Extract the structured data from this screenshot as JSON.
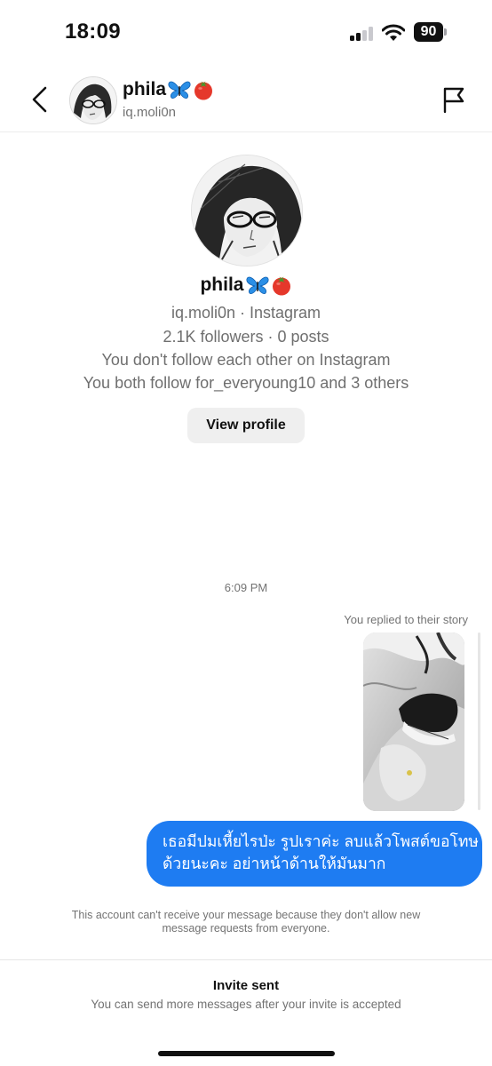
{
  "status_bar": {
    "time": "18:09",
    "battery": "90",
    "icons": [
      "cellular-signal-icon",
      "wifi-icon",
      "battery-icon"
    ]
  },
  "header": {
    "name": "phila",
    "name_emojis": [
      "butterfly-emoji",
      "tomato-emoji"
    ],
    "username": "iq.moli0n",
    "icons": [
      "chevron-left-icon",
      "flag-icon"
    ]
  },
  "profile": {
    "name": "phila",
    "meta": "iq.moli0n · Instagram",
    "stats": "2.1K followers · 0 posts",
    "follow_status": "You don't follow each other on Instagram",
    "mutuals": "You both follow for_everyoung10 and 3 others",
    "view_profile_label": "View profile"
  },
  "conversation": {
    "timestamp": "6:09 PM",
    "story_reply_label": "You replied to their story",
    "message_lines": [
      "เธอมีปมเหี้ยไรป่ะ รูปเราค่ะ ลบแล้วโพสต์ขอโทษ",
      "ด้วยนะคะ อย่าหน้าด้านให้มันมาก"
    ],
    "notice": "This account can't receive your message because they don't allow new message requests from everyone."
  },
  "footer": {
    "title": "Invite sent",
    "subtitle": "You can send more messages after your invite is accepted"
  },
  "colors": {
    "bubble": "#1e7cf2",
    "secondary_text": "#737373",
    "button_bg": "#efefef"
  }
}
